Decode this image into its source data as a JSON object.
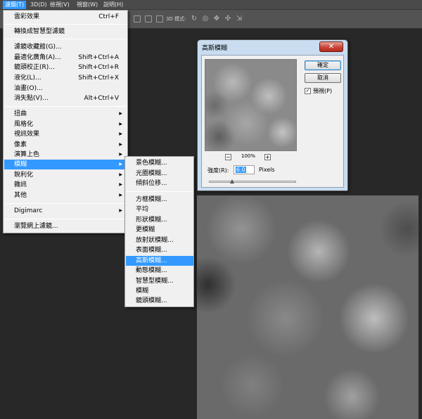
{
  "menubar": {
    "items": [
      "濾鏡(T)",
      "3D(D)",
      "檢視(V)",
      "視窗(W)",
      "說明(H)"
    ]
  },
  "optionsbar": {
    "mode_label": "3D 模式:"
  },
  "filter_menu": {
    "top_items": [
      {
        "label": "雲彩效果",
        "shortcut": "Ctrl+F"
      },
      {
        "label": "轉換成智慧型濾鏡",
        "shortcut": ""
      },
      {
        "label": "濾鏡收藏館(G)...",
        "shortcut": ""
      },
      {
        "label": "最適化廣角(A)...",
        "shortcut": "Shift+Ctrl+A"
      },
      {
        "label": "鏡頭校正(R)...",
        "shortcut": "Shift+Ctrl+R"
      },
      {
        "label": "液化(L)...",
        "shortcut": "Shift+Ctrl+X"
      },
      {
        "label": "油畫(O)...",
        "shortcut": ""
      },
      {
        "label": "消失點(V)...",
        "shortcut": "Alt+Ctrl+V"
      }
    ],
    "sub_items": [
      "扭曲",
      "風格化",
      "視訊效果",
      "像素",
      "演算上色",
      "模糊",
      "銳利化",
      "雜訊",
      "其他"
    ],
    "digimarc": "Digimarc",
    "browse": "瀏覽網上濾鏡...",
    "highlighted": "模糊"
  },
  "blur_submenu": {
    "group1": [
      "景色模糊...",
      "光圈模糊...",
      "傾斜位移..."
    ],
    "group2": [
      "方框模糊...",
      "平均",
      "形狀模糊...",
      "更模糊",
      "放射狀模糊...",
      "表面模糊...",
      "高斯模糊...",
      "動態模糊...",
      "智慧型模糊...",
      "模糊",
      "鏡頭模糊..."
    ],
    "highlighted": "高斯模糊..."
  },
  "dialog": {
    "title": "高斯模糊",
    "close_label": "✕",
    "ok_label": "確定",
    "cancel_label": "取消",
    "preview_label": "預視(P)",
    "preview_checked": true,
    "zoom_minus": "−",
    "zoom_plus": "+",
    "zoom": "100%",
    "radius_label": "強度(R):",
    "radius_value": "6.0",
    "radius_unit": "Pixels",
    "slider_position": 0.27
  },
  "colors": {
    "highlight": "#3399ff",
    "menu_bg": "#f0f0f0",
    "workspace": "#282828"
  }
}
